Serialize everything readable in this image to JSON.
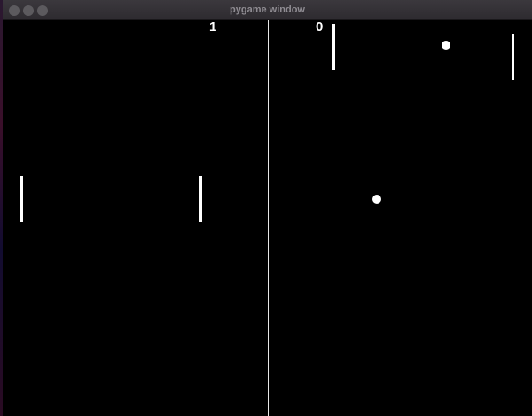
{
  "window": {
    "title": "pygame window"
  },
  "scores": {
    "left": "1",
    "right": "0"
  },
  "colors": {
    "background": "#000000",
    "foreground": "#ffffff",
    "titlebar": "#2e2b30"
  }
}
